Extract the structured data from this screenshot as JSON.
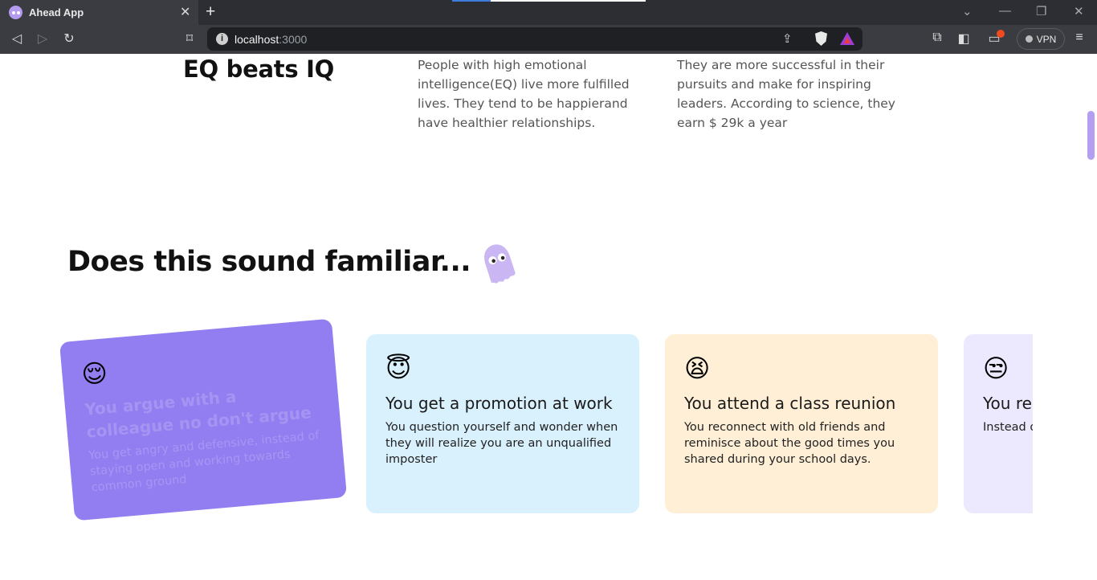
{
  "browser": {
    "tab_title": "Ahead App",
    "tab_close": "✕",
    "new_tab": "+",
    "url_host": "localhost",
    "url_port": ":3000",
    "vpn_label": "VPN",
    "icons": {
      "back": "back-arrow-icon",
      "forward": "forward-arrow-icon",
      "reload": "reload-icon",
      "bookmark": "bookmark-icon",
      "site_info": "info-icon",
      "share": "share-icon",
      "brave_shields": "brave-shield-icon",
      "brave_rewards": "rewards-triangle-icon",
      "extensions": "puzzle-icon",
      "sidebar": "sidebar-icon",
      "wallet": "wallet-icon",
      "menu": "hamburger-menu-icon"
    },
    "controls": {
      "back": "◁",
      "forward": "▷",
      "reload": "↻",
      "bookmark": "⌑",
      "share": "⇪",
      "extensions": "⧉",
      "sidebar": "◧",
      "wallet": "▭",
      "menu": "≡",
      "tabs_dropdown": "⌄",
      "minimize": "—",
      "restore": "❐",
      "close": "✕"
    }
  },
  "intro": {
    "title": "EQ beats IQ",
    "column1": "People with high emotional intelligence(EQ) live more fulfilled lives. They tend to be happierand have healthier relationships.",
    "column2": "They are more successful in their pursuits and make for inspiring leaders. According to science, they earn $ 29k a year"
  },
  "familiar": {
    "title": "Does this sound familiar...",
    "mascot": "ghost-mascot-icon"
  },
  "cards": [
    {
      "emoji": "😌",
      "title": "You argue with a colleague no don't argue",
      "description": "You get angry and defensive, instead of staying open and working towards common ground",
      "color": "#927ef0"
    },
    {
      "emoji": "😇",
      "title": "You get a promotion at work",
      "description": "You question yourself and wonder when they will realize you are an unqualified imposter",
      "color": "#d9f0fd"
    },
    {
      "emoji": "😫",
      "title": "You attend a class reunion",
      "description": "You reconnect with old friends and reminisce about the good times you shared during your school days.",
      "color": "#ffefd6"
    },
    {
      "emoji": "😒",
      "title": "You receive feedback",
      "description": "Instead of becoming ... hindering",
      "color": "#ece8fd"
    }
  ],
  "colors": {
    "accent": "#927ef0",
    "scrollbar": "#b49ef2"
  }
}
